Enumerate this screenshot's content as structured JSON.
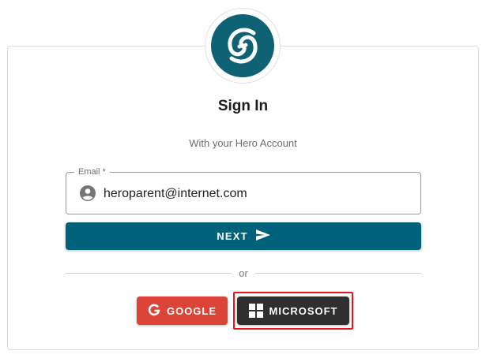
{
  "page": {
    "title": "Sign In",
    "subtitle": "With your Hero Account"
  },
  "logo": {
    "icon": "hero-logo-icon",
    "color": "#0f6273"
  },
  "email": {
    "label": "Email *",
    "value": "heroparent@internet.com",
    "icon": "account-circle-icon"
  },
  "next_button": {
    "label": "NEXT",
    "icon": "send-icon",
    "color": "#00627a"
  },
  "divider": {
    "label": "or"
  },
  "social": {
    "google": {
      "label": "GOOGLE",
      "icon": "google-g-icon",
      "color": "#db4437"
    },
    "microsoft": {
      "label": "MICROSOFT",
      "icon": "windows-logo-icon",
      "color": "#2f2f2f"
    }
  },
  "highlight_color": "#e8141c"
}
